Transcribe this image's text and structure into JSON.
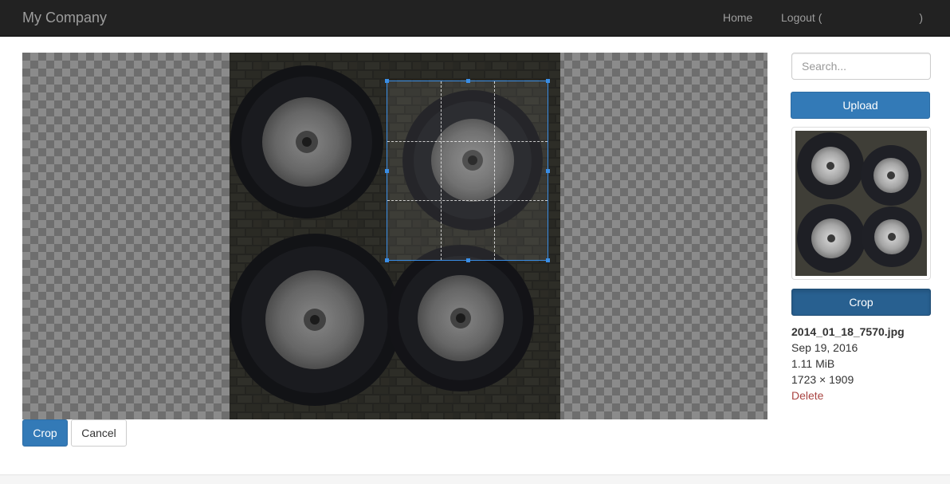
{
  "navbar": {
    "brand": "My Company",
    "home": "Home",
    "logout": "Logout (",
    "logout_close": ")"
  },
  "editor": {
    "crop_button": "Crop",
    "cancel_button": "Cancel"
  },
  "sidebar": {
    "search_placeholder": "Search...",
    "upload_button": "Upload",
    "crop_button": "Crop",
    "file": {
      "name": "2014_01_18_7570.jpg",
      "date": "Sep 19, 2016",
      "size": "1.11 MiB",
      "dimensions": "1723 × 1909",
      "delete": "Delete"
    }
  },
  "colors": {
    "navbar_bg": "#222222",
    "primary": "#337ab7",
    "crop_selection": "#3a8ee6",
    "danger": "#a94442"
  }
}
